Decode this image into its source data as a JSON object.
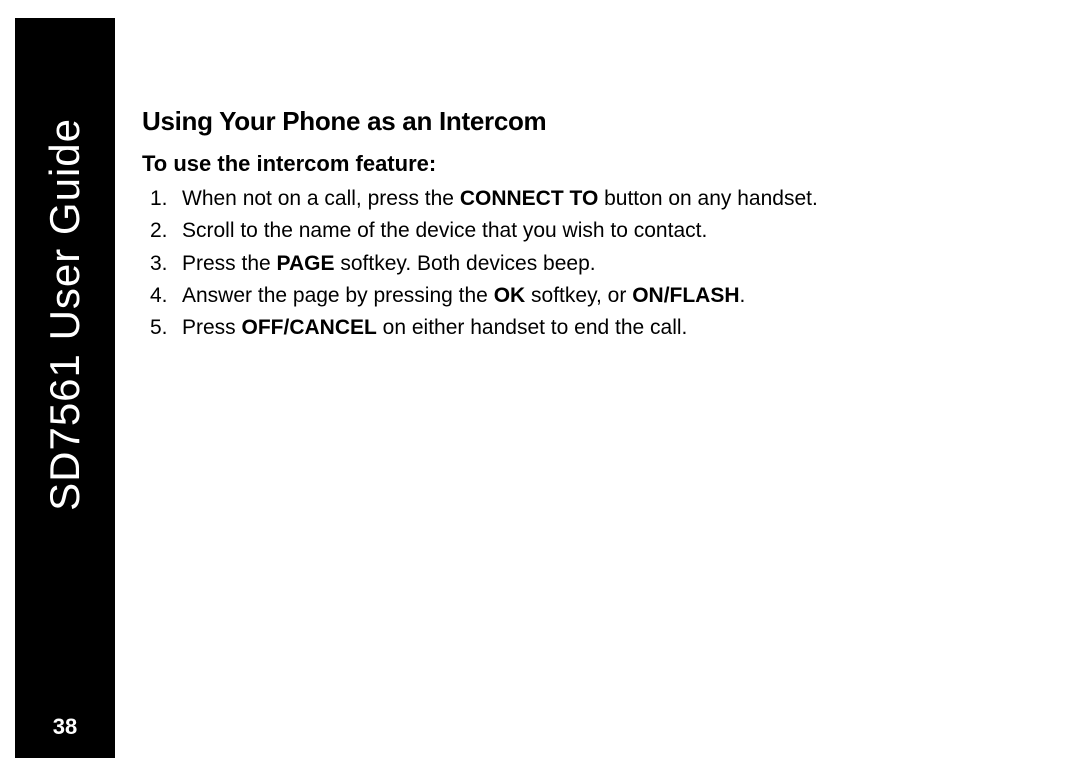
{
  "sidebar": {
    "title": "SD7561 User Guide",
    "page_number": "38"
  },
  "content": {
    "section_heading": "Using Your Phone as an Intercom",
    "sub_heading": "To use the intercom feature:",
    "steps": [
      {
        "num": "1.",
        "pre": "When not on a call, press the ",
        "bold1": "CONNECT TO",
        "post": " button on any handset."
      },
      {
        "num": "2.",
        "pre": "Scroll to the name of the device that you wish to contact.",
        "bold1": "",
        "post": ""
      },
      {
        "num": "3.",
        "pre": "Press the ",
        "bold1": "PAGE",
        "post": " softkey. Both devices beep."
      },
      {
        "num": "4.",
        "pre": "Answer the page by pressing the ",
        "bold1": "OK",
        "mid": " softkey, or ",
        "bold2": "ON/FLASH",
        "post": "."
      },
      {
        "num": "5.",
        "pre": "Press ",
        "bold1": "OFF/CANCEL",
        "post": " on either handset to end the call."
      }
    ]
  }
}
